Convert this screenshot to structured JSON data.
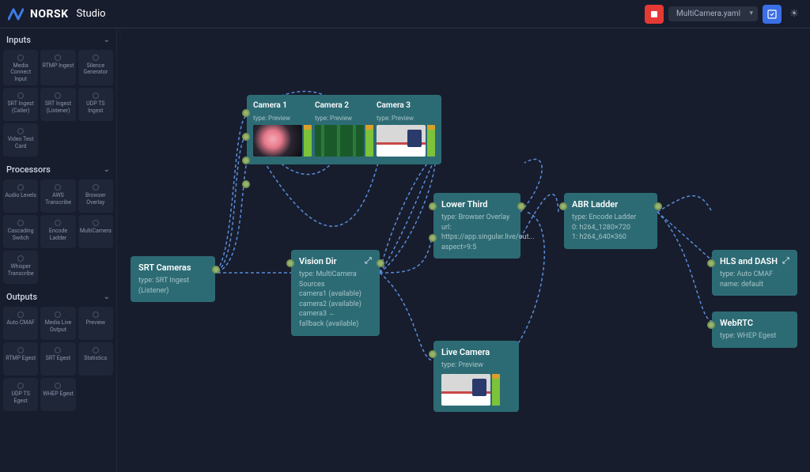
{
  "header": {
    "brand": "NORSK",
    "product": "Studio",
    "filename": "MultiCamera.yaml"
  },
  "sidebar": {
    "sections": [
      {
        "title": "Inputs",
        "tiles": [
          "Media Connect Input",
          "RTMP Ingest",
          "Silence Generator",
          "SRT Ingest (Caller)",
          "SRT Ingest (Listener)",
          "UDP TS Ingest",
          "Video Test Card"
        ]
      },
      {
        "title": "Processors",
        "tiles": [
          "Audio Levels",
          "AWS Transcribe",
          "Browser Overlay",
          "Cascading Switch",
          "Encode Ladder",
          "MultiCamera",
          "Whisper Transcribe"
        ]
      },
      {
        "title": "Outputs",
        "tiles": [
          "Auto CMAF",
          "Media Live Output",
          "Preview",
          "RTMP Egest",
          "SRT Egest",
          "Statistics",
          "UDP TS Egest",
          "WHEP Egest"
        ]
      }
    ]
  },
  "nodes": {
    "srtCameras": {
      "title": "SRT Cameras",
      "type": "type: SRT Ingest (Listener)"
    },
    "cameras": {
      "cam1": {
        "title": "Camera 1",
        "type": "type: Preview"
      },
      "cam2": {
        "title": "Camera 2",
        "type": "type: Preview"
      },
      "cam3": {
        "title": "Camera 3",
        "type": "type: Preview"
      }
    },
    "visionDir": {
      "title": "Vision Dir",
      "type": "type: MultiCamera",
      "l1": "Sources",
      "l2": "camera1 (available)",
      "l3": "camera2 (available)",
      "l4": "camera3 ←",
      "l5": "fallback (available)"
    },
    "lowerThird": {
      "title": "Lower Third",
      "l1": "type: Browser Overlay",
      "l2": "url:",
      "l3": "https://app.singular.live/out...",
      "l4": "aspect=9:5"
    },
    "abrLadder": {
      "title": "ABR Ladder",
      "l1": "type: Encode Ladder",
      "l2": "0: h264_1280×720",
      "l3": "1: h264_640×360"
    },
    "liveCamera": {
      "title": "Live Camera",
      "type": "type: Preview"
    },
    "hlsDash": {
      "title": "HLS and DASH",
      "l1": "type: Auto CMAF",
      "l2": "name: default"
    },
    "webrtc": {
      "title": "WebRTC",
      "l1": "type: WHEP Egest"
    }
  }
}
